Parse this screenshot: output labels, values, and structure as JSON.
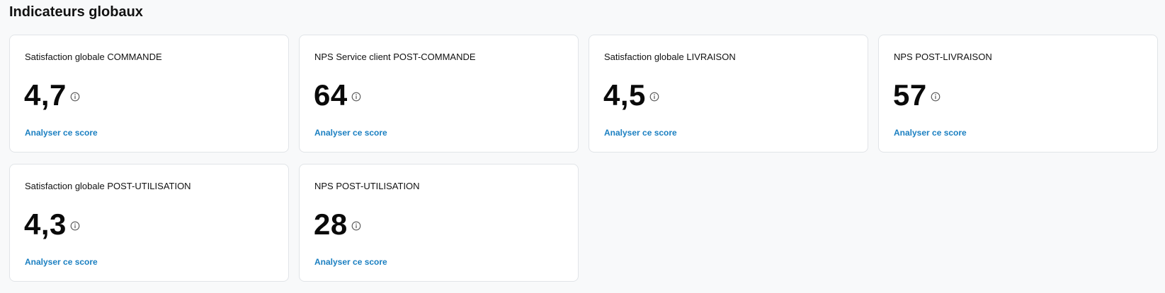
{
  "section": {
    "title": "Indicateurs globaux"
  },
  "cards": [
    {
      "title": "Satisfaction globale COMMANDE",
      "value": "4,7",
      "link": "Analyser ce score",
      "icon": "info-icon"
    },
    {
      "title": "NPS Service client POST-COMMANDE",
      "value": "64",
      "link": "Analyser ce score",
      "icon": "info-icon"
    },
    {
      "title": "Satisfaction globale LIVRAISON",
      "value": "4,5",
      "link": "Analyser ce score",
      "icon": "info-icon"
    },
    {
      "title": "NPS POST-LIVRAISON",
      "value": "57",
      "link": "Analyser ce score",
      "icon": "info-icon"
    },
    {
      "title": "Satisfaction globale POST-UTILISATION",
      "value": "4,3",
      "link": "Analyser ce score",
      "icon": "info-icon"
    },
    {
      "title": "NPS POST-UTILISATION",
      "value": "28",
      "link": "Analyser ce score",
      "icon": "info-icon"
    }
  ],
  "colors": {
    "link": "#1a7fc1",
    "background": "#f8f9fa",
    "card_border": "#e1e4e8",
    "icon": "#555555"
  }
}
